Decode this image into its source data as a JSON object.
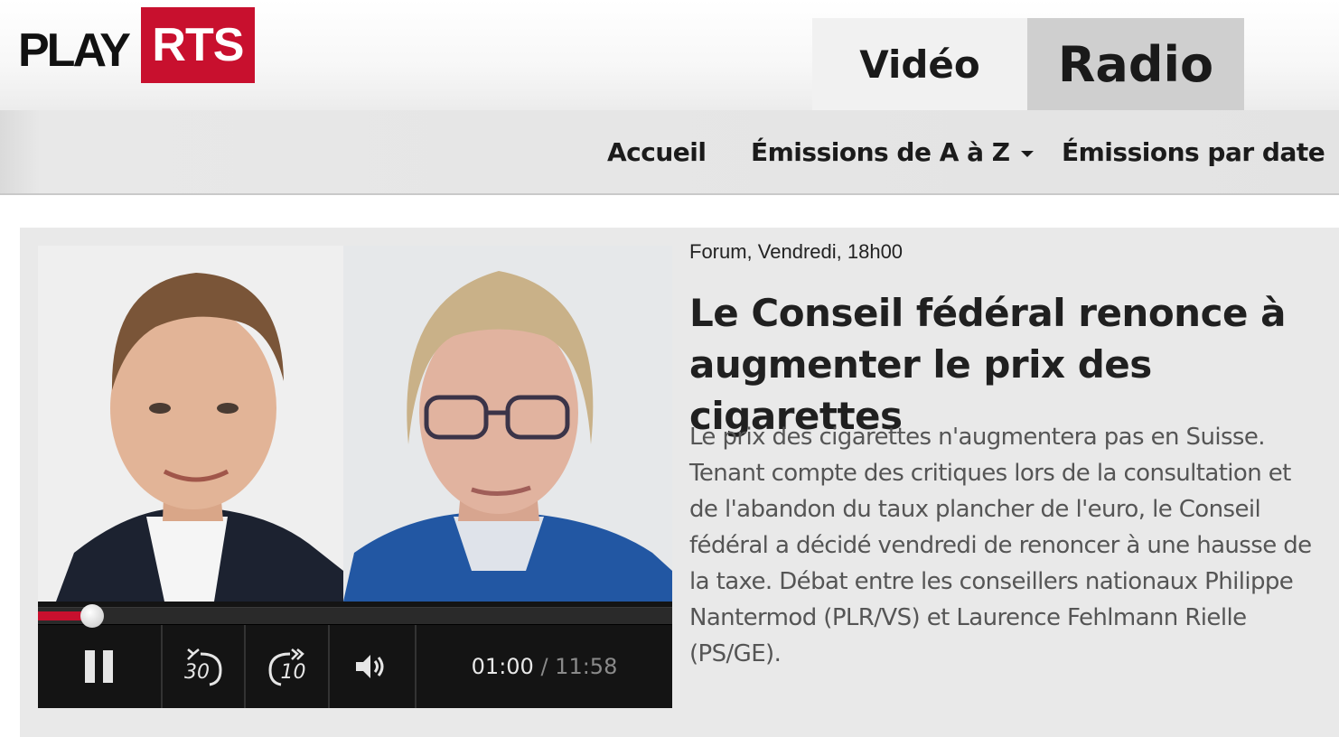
{
  "brand": {
    "play": "PLAY",
    "rts": "RTS",
    "accent": "#c8102e"
  },
  "tabs": [
    {
      "label": "Vidéo",
      "active": false
    },
    {
      "label": "Radio",
      "active": true
    }
  ],
  "nav": {
    "accueil": "Accueil",
    "emissions_az": "Émissions de A à Z",
    "emissions_date": "Émissions par date"
  },
  "episode": {
    "meta": "Forum, Vendredi, 18h00",
    "title": "Le Conseil fédéral renonce à augmenter le prix des cigarettes",
    "description": "Le prix des cigarettes n'augmentera pas en Suisse. Tenant compte des critiques lors de la consultation et de l'abandon du taux plancher de l'euro, le Conseil fédéral a décidé vendredi de renoncer à une hausse de la taxe. Débat entre les conseillers nationaux Philippe Nantermod (PLR/VS) et Laurence Fehlmann Rielle (PS/GE)."
  },
  "player": {
    "current_time": "01:00",
    "separator": " / ",
    "total_time": "11:58",
    "progress_fraction": 0.0836,
    "skip_back": "30",
    "skip_forward": "10",
    "state": "playing"
  }
}
